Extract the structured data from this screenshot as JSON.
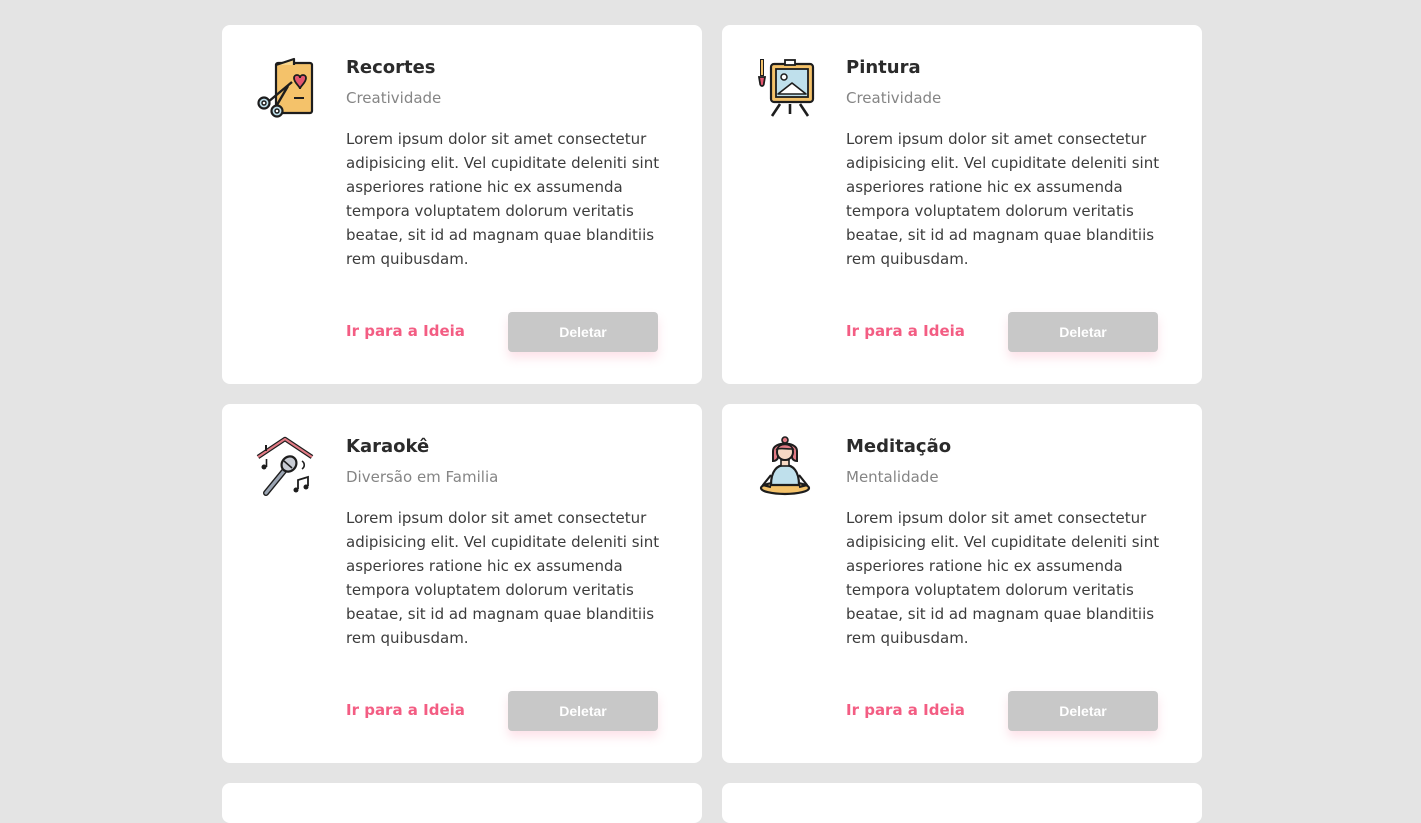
{
  "ideas": [
    {
      "title": "Recortes",
      "category": "Creatividade",
      "description": "Lorem ipsum dolor sit amet consectetur adipisicing elit. Vel cupiditate deleniti sint asperiores ratione hic ex assumenda tempora voluptatem dolorum veritatis beatae, sit id ad magnam quae blanditiis rem quibusdam.",
      "link_label": "Ir para a Ideia",
      "delete_label": "Deletar",
      "icon": "scissors-card-icon"
    },
    {
      "title": "Pintura",
      "category": "Creatividade",
      "description": "Lorem ipsum dolor sit amet consectetur adipisicing elit. Vel cupiditate deleniti sint asperiores ratione hic ex assumenda tempora voluptatem dolorum veritatis beatae, sit id ad magnam quae blanditiis rem quibusdam.",
      "link_label": "Ir para a Ideia",
      "delete_label": "Deletar",
      "icon": "easel-painting-icon"
    },
    {
      "title": "Karaokê",
      "category": "Diversão em Familia",
      "description": "Lorem ipsum dolor sit amet consectetur adipisicing elit. Vel cupiditate deleniti sint asperiores ratione hic ex assumenda tempora voluptatem dolorum veritatis beatae, sit id ad magnam quae blanditiis rem quibusdam.",
      "link_label": "Ir para a Ideia",
      "delete_label": "Deletar",
      "icon": "microphone-house-icon"
    },
    {
      "title": "Meditação",
      "category": "Mentalidade",
      "description": "Lorem ipsum dolor sit amet consectetur adipisicing elit. Vel cupiditate deleniti sint asperiores ratione hic ex assumenda tempora voluptatem dolorum veritatis beatae, sit id ad magnam quae blanditiis rem quibusdam.",
      "link_label": "Ir para a Ideia",
      "delete_label": "Deletar",
      "icon": "meditation-person-icon"
    }
  ],
  "colors": {
    "background": "#e4e4e4",
    "card": "#ffffff",
    "link": "#f35d83",
    "delete_button": "#c8c8c8",
    "title": "#2b2b2b",
    "category": "#858585"
  }
}
